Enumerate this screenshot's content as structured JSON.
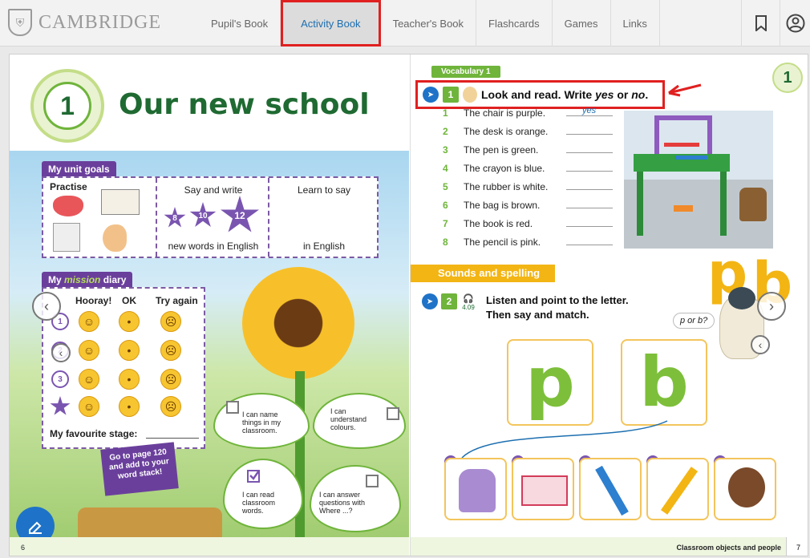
{
  "header": {
    "logo_text": "CAMBRIDGE",
    "tabs": [
      {
        "label": "Pupil's Book",
        "active": false
      },
      {
        "label": "Activity Book",
        "active": true
      },
      {
        "label": "Teacher's Book",
        "active": false
      },
      {
        "label": "Flashcards",
        "active": false
      },
      {
        "label": "Games",
        "active": false
      },
      {
        "label": "Links",
        "active": false
      }
    ],
    "accent_color": "#1d6fb0",
    "highlight_color": "#e02020"
  },
  "left_page": {
    "unit_number": "1",
    "unit_title": "Our new school",
    "goals": {
      "tag": "My unit goals",
      "practise_label": "Practise",
      "say_write_label": "Say and write",
      "stars": [
        "8",
        "10",
        "12"
      ],
      "new_words_label": "new words in English",
      "learn_label": "Learn to say",
      "in_english_label": "in English"
    },
    "diary": {
      "tag_prefix": "My",
      "tag_word": "mission",
      "tag_suffix": "diary",
      "columns": [
        "Hooray!",
        "OK",
        "Try again"
      ],
      "rows": [
        "1",
        "2",
        "3",
        "★"
      ],
      "favourite_label": "My favourite stage:"
    },
    "sign_text": "Go to page 120 and add to your word stack!",
    "leaves": [
      "I can name things in my classroom.",
      "I can understand colours.",
      "I can read classroom words.",
      "I can answer questions with Where ...?"
    ],
    "page_number": "6"
  },
  "right_page": {
    "vocab_tag": "Vocabulary 1",
    "page_badge": "1",
    "exercise1": {
      "number": "1",
      "instruction_a": "Look and read. Write ",
      "instruction_yes": "yes",
      "instruction_or": " or ",
      "instruction_no": "no",
      "instruction_end": ".",
      "sentences": [
        {
          "n": "1",
          "text": "The chair is purple.",
          "answer": "yes"
        },
        {
          "n": "2",
          "text": "The desk is orange.",
          "answer": ""
        },
        {
          "n": "3",
          "text": "The pen is green.",
          "answer": ""
        },
        {
          "n": "4",
          "text": "The crayon is blue.",
          "answer": ""
        },
        {
          "n": "5",
          "text": "The rubber is white.",
          "answer": ""
        },
        {
          "n": "6",
          "text": "The bag is brown.",
          "answer": ""
        },
        {
          "n": "7",
          "text": "The book is red.",
          "answer": ""
        },
        {
          "n": "8",
          "text": "The pencil is pink.",
          "answer": ""
        }
      ]
    },
    "sounds_tag": "Sounds and spelling",
    "exercise2": {
      "number": "2",
      "audio_track": "4.09",
      "line1": "Listen and point to the letter.",
      "line2": "Then say and match.",
      "letters": [
        "p",
        "b"
      ],
      "speech": "p or b?",
      "picture_numbers": [
        "1",
        "2",
        "3",
        "4",
        "5"
      ]
    },
    "footer_text": "Classroom objects and people",
    "page_number": "7"
  }
}
